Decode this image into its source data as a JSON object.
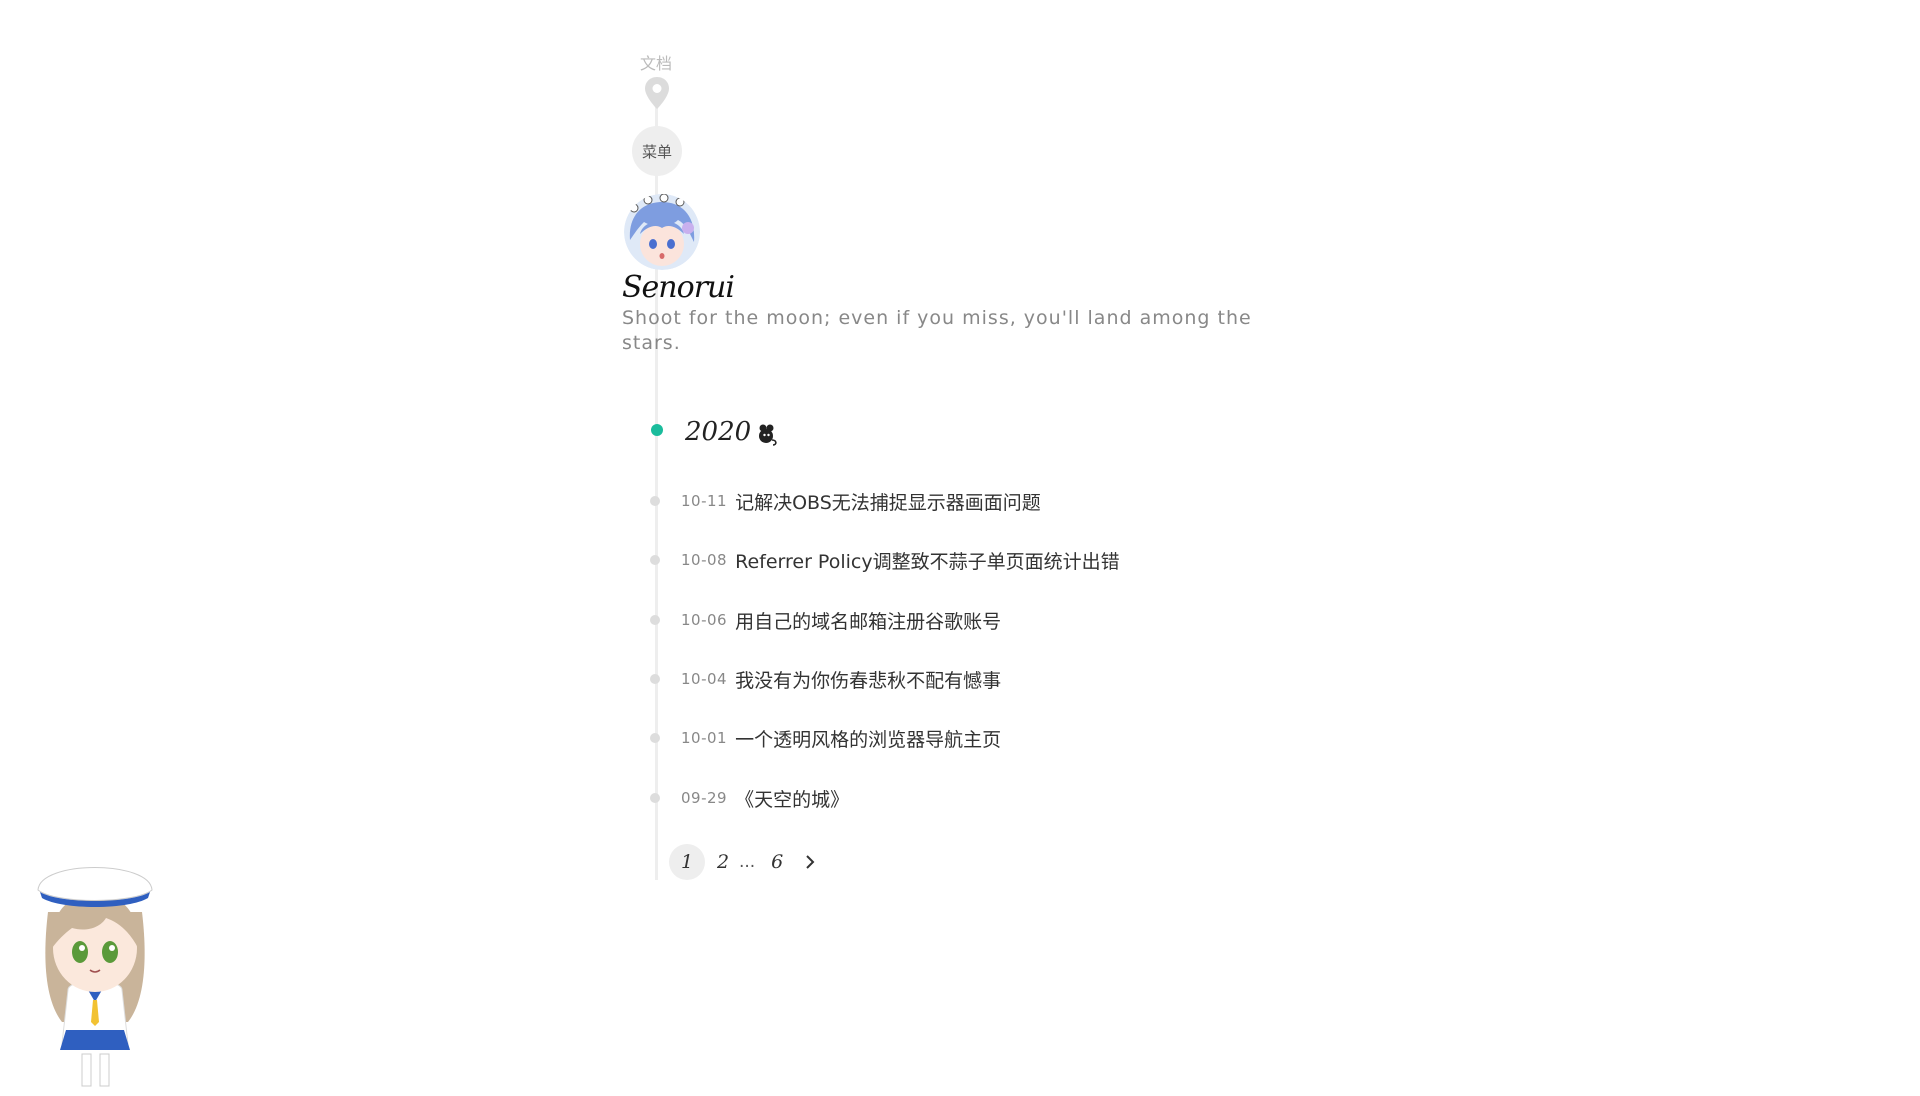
{
  "nav": {
    "docs_label": "文档",
    "menu_label": "菜单"
  },
  "site": {
    "title": "Senorui",
    "motto": "Shoot for the moon; even if you miss, you'll land among the stars."
  },
  "timeline": {
    "year": "2020",
    "posts": [
      {
        "date": "10-11",
        "title": "记解决OBS无法捕捉显示器画面问题"
      },
      {
        "date": "10-08",
        "title": "Referrer Policy调整致不蒜子单页面统计出错"
      },
      {
        "date": "10-06",
        "title": "用自己的域名邮箱注册谷歌账号"
      },
      {
        "date": "10-04",
        "title": "我没有为你伤春悲秋不配有憾事"
      },
      {
        "date": "10-01",
        "title": "一个透明风格的浏览器导航主页"
      },
      {
        "date": "09-29",
        "title": "《天空的城》"
      }
    ]
  },
  "pagination": {
    "current": "1",
    "next_page": "2",
    "ellipsis": "...",
    "last_page": "6"
  },
  "colors": {
    "accent": "#1abc9c",
    "rail": "#eeeeee",
    "muted": "#888888"
  },
  "icons": [
    "location-pin-icon",
    "avatar",
    "year-mascot-icon",
    "chevron-right-icon",
    "mascot"
  ]
}
